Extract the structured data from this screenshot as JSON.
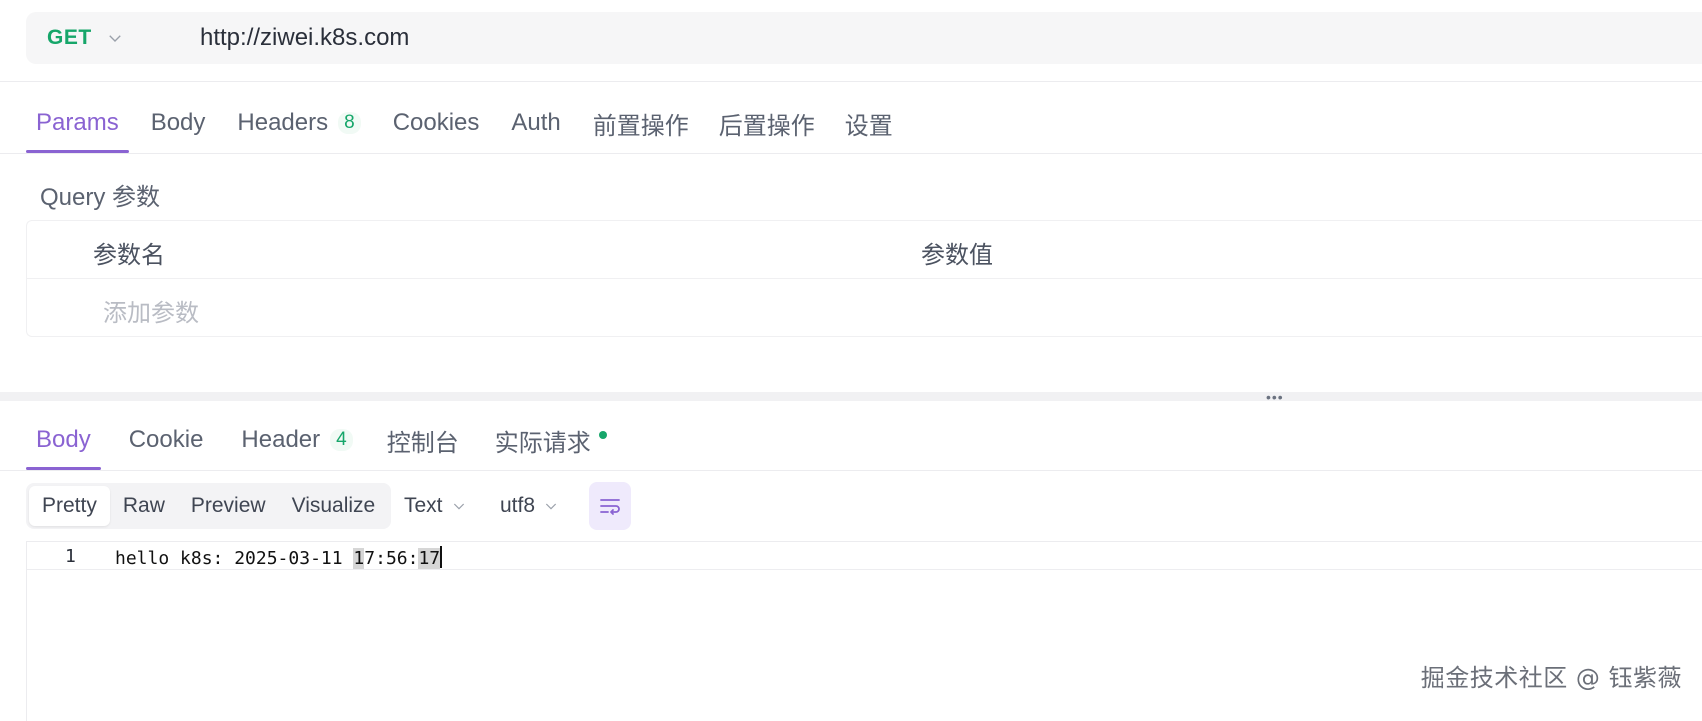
{
  "request": {
    "method": "GET",
    "url": "http://ziwei.k8s.com"
  },
  "request_tabs": [
    {
      "label": "Params",
      "active": true
    },
    {
      "label": "Body"
    },
    {
      "label": "Headers",
      "badge": "8"
    },
    {
      "label": "Cookies"
    },
    {
      "label": "Auth"
    },
    {
      "label": "前置操作"
    },
    {
      "label": "后置操作"
    },
    {
      "label": "设置"
    }
  ],
  "query": {
    "title": "Query 参数",
    "col_name": "参数名",
    "col_value": "参数值",
    "add_placeholder": "添加参数"
  },
  "response_tabs": [
    {
      "label": "Body",
      "active": true
    },
    {
      "label": "Cookie"
    },
    {
      "label": "Header",
      "badge": "4"
    },
    {
      "label": "控制台"
    },
    {
      "label": "实际请求",
      "dot": true
    }
  ],
  "view_modes": [
    "Pretty",
    "Raw",
    "Preview",
    "Visualize"
  ],
  "active_view_mode": "Pretty",
  "format": "Text",
  "encoding": "utf8",
  "code": {
    "line_number": "1",
    "prefix": "hello k8s: 2025-03-11 ",
    "hl1": "1",
    "mid": "7:56:",
    "hl2": "17"
  },
  "watermark": "掘金技术社区 @ 钰紫薇",
  "colors": {
    "accent": "#8a63d2",
    "method_green": "#16a66a"
  }
}
